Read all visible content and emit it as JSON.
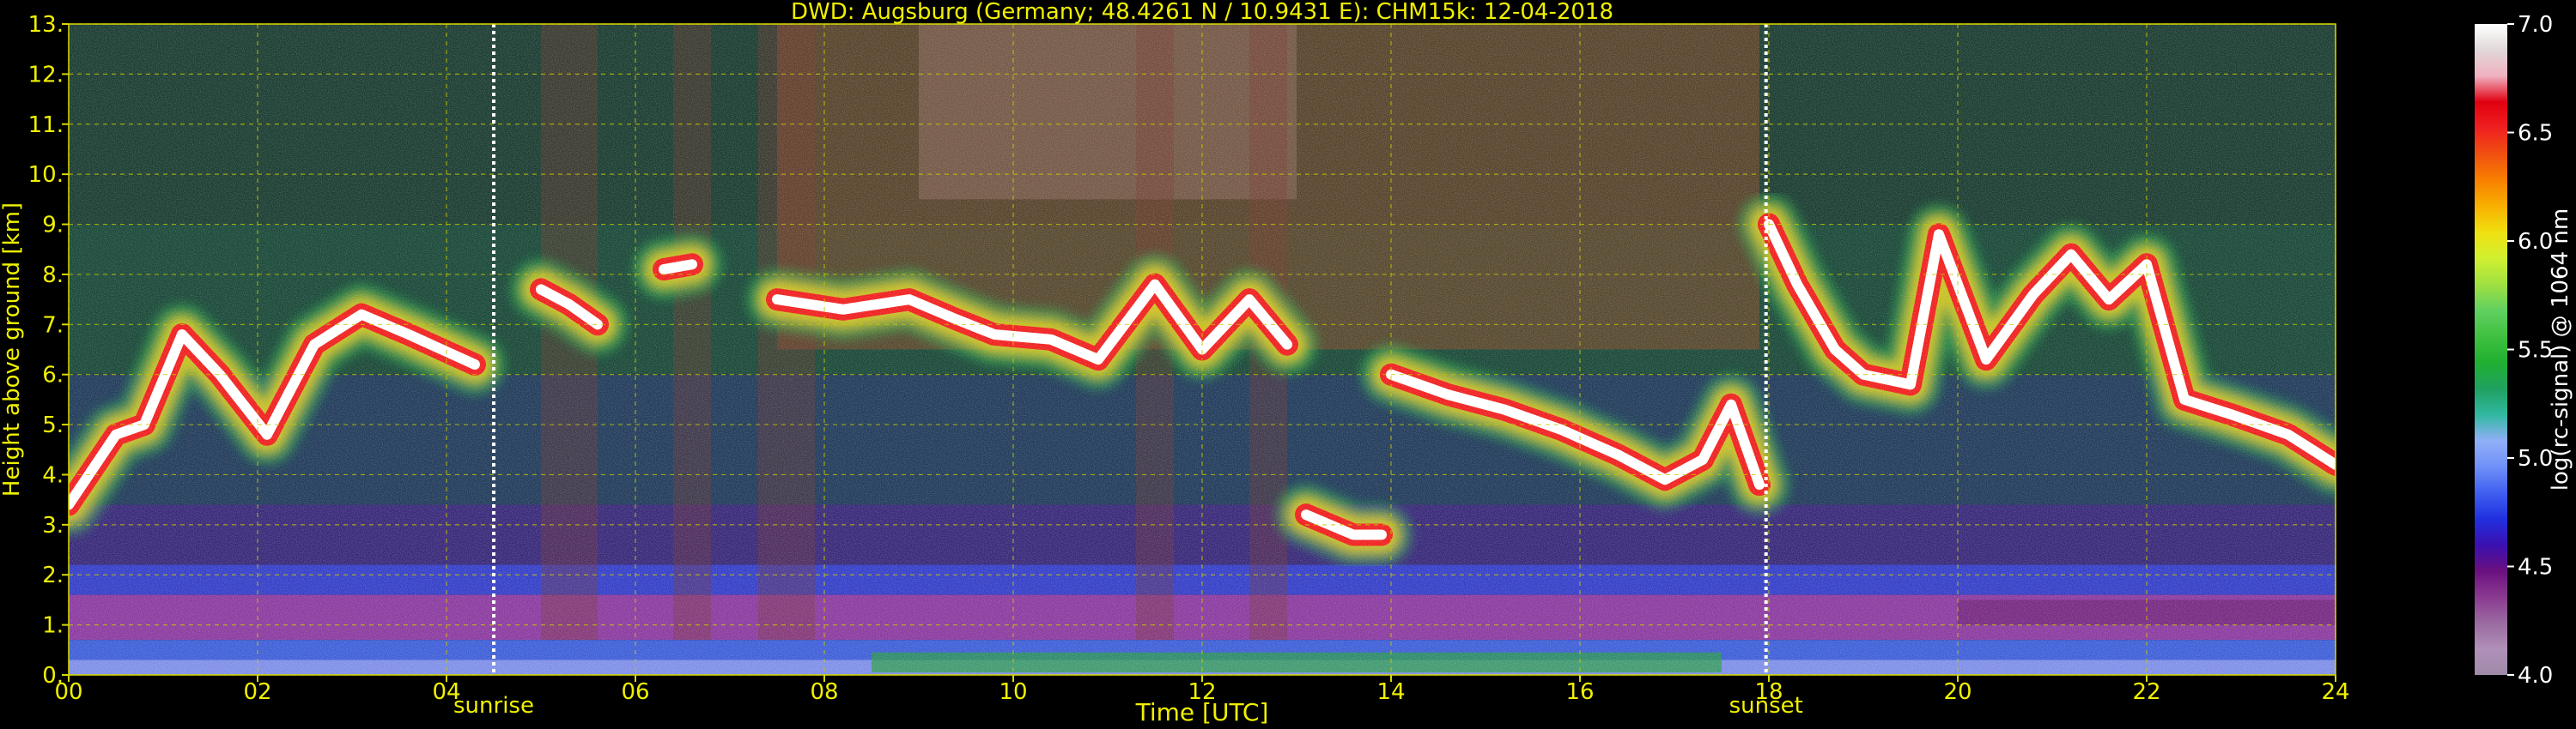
{
  "chart_data": {
    "type": "heatmap",
    "title": "DWD: Augsburg (Germany; 48.4261 N / 10.9431 E):    CHM15k: 12-04-2018",
    "xlabel": "Time [UTC]",
    "ylabel": "Height above ground [km]",
    "xlim": [
      0,
      24
    ],
    "ylim": [
      0,
      13
    ],
    "x_ticks": [
      {
        "value": 0,
        "label": "00"
      },
      {
        "value": 2,
        "label": "02"
      },
      {
        "value": 4,
        "label": "04"
      },
      {
        "value": 6,
        "label": "06"
      },
      {
        "value": 8,
        "label": "08"
      },
      {
        "value": 10,
        "label": "10"
      },
      {
        "value": 12,
        "label": "12"
      },
      {
        "value": 14,
        "label": "14"
      },
      {
        "value": 16,
        "label": "16"
      },
      {
        "value": 18,
        "label": "18"
      },
      {
        "value": 20,
        "label": "20"
      },
      {
        "value": 22,
        "label": "22"
      },
      {
        "value": 24,
        "label": "24"
      }
    ],
    "y_ticks": [
      {
        "value": 0,
        "label": "0."
      },
      {
        "value": 1,
        "label": "1."
      },
      {
        "value": 2,
        "label": "2."
      },
      {
        "value": 3,
        "label": "3."
      },
      {
        "value": 4,
        "label": "4."
      },
      {
        "value": 5,
        "label": "5."
      },
      {
        "value": 6,
        "label": "6."
      },
      {
        "value": 7,
        "label": "7."
      },
      {
        "value": 8,
        "label": "8."
      },
      {
        "value": 9,
        "label": "9."
      },
      {
        "value": 10,
        "label": "10."
      },
      {
        "value": 11,
        "label": "11."
      },
      {
        "value": 12,
        "label": "12."
      },
      {
        "value": 13,
        "label": "13."
      }
    ],
    "grid": true,
    "markers": [
      {
        "time": 4.5,
        "label": "sunrise"
      },
      {
        "time": 17.97,
        "label": "sunset"
      }
    ],
    "colorbar": {
      "label": "log(rc-signal) @ 1064 nm",
      "range": [
        4.0,
        7.0
      ],
      "tick_labels": [
        {
          "value": 4.0,
          "label": "4.0"
        },
        {
          "value": 4.5,
          "label": "4.5"
        },
        {
          "value": 5.0,
          "label": "5.0"
        },
        {
          "value": 5.5,
          "label": "5.5"
        },
        {
          "value": 6.0,
          "label": "6.0"
        },
        {
          "value": 6.5,
          "label": "6.5"
        },
        {
          "value": 7.0,
          "label": "7.0"
        }
      ],
      "colors": [
        "#a08aa8",
        "#b090b8",
        "#9a6aa0",
        "#8a3a90",
        "#6a1080",
        "#3a10b0",
        "#2030e0",
        "#4060f0",
        "#7090f8",
        "#90b0f8",
        "#30b8a0",
        "#20a060",
        "#20b030",
        "#40c040",
        "#60d060",
        "#a0e040",
        "#d0f030",
        "#f0e010",
        "#f8b000",
        "#f88000",
        "#f05010",
        "#f02020",
        "#e00010",
        "#f0b0c0",
        "#e0d8d8",
        "#ffffff"
      ]
    },
    "cloud_layers": [
      {
        "name": "",
        "points": [
          [
            0.0,
            3.4
          ],
          [
            0.5,
            4.8
          ],
          [
            0.8,
            5.0
          ],
          [
            1.2,
            6.8
          ],
          [
            1.6,
            6.0
          ],
          [
            2.1,
            4.8
          ],
          [
            2.6,
            6.6
          ],
          [
            3.1,
            7.2
          ],
          [
            3.6,
            6.8
          ],
          [
            4.3,
            6.2
          ]
        ]
      },
      {
        "name": "",
        "points": [
          [
            5.0,
            7.7
          ],
          [
            5.3,
            7.4
          ],
          [
            5.6,
            7.0
          ]
        ]
      },
      {
        "name": "",
        "points": [
          [
            6.3,
            8.1
          ],
          [
            6.6,
            8.2
          ]
        ]
      },
      {
        "name": "",
        "points": [
          [
            7.5,
            7.5
          ],
          [
            8.2,
            7.3
          ],
          [
            8.9,
            7.5
          ],
          [
            9.4,
            7.1
          ],
          [
            9.8,
            6.8
          ],
          [
            10.4,
            6.7
          ],
          [
            10.9,
            6.3
          ],
          [
            11.5,
            7.8
          ],
          [
            12.0,
            6.5
          ],
          [
            12.5,
            7.5
          ],
          [
            12.9,
            6.6
          ]
        ]
      },
      {
        "name": "",
        "points": [
          [
            13.1,
            3.2
          ],
          [
            13.6,
            2.8
          ],
          [
            13.9,
            2.8
          ]
        ]
      },
      {
        "name": "",
        "points": [
          [
            14.0,
            6.0
          ],
          [
            14.6,
            5.6
          ],
          [
            15.2,
            5.3
          ],
          [
            15.8,
            4.9
          ],
          [
            16.4,
            4.4
          ],
          [
            16.9,
            3.9
          ],
          [
            17.3,
            4.3
          ],
          [
            17.6,
            5.4
          ],
          [
            17.9,
            3.8
          ]
        ]
      },
      {
        "name": "",
        "points": [
          [
            18.0,
            9.0
          ],
          [
            18.3,
            7.8
          ],
          [
            18.7,
            6.5
          ],
          [
            19.0,
            6.0
          ],
          [
            19.5,
            5.8
          ],
          [
            19.8,
            8.8
          ],
          [
            20.3,
            6.3
          ],
          [
            20.8,
            7.6
          ],
          [
            21.2,
            8.4
          ],
          [
            21.6,
            7.5
          ],
          [
            22.0,
            8.2
          ],
          [
            22.4,
            5.5
          ],
          [
            22.9,
            5.2
          ],
          [
            23.5,
            4.8
          ],
          [
            24.0,
            4.2
          ]
        ]
      }
    ]
  }
}
